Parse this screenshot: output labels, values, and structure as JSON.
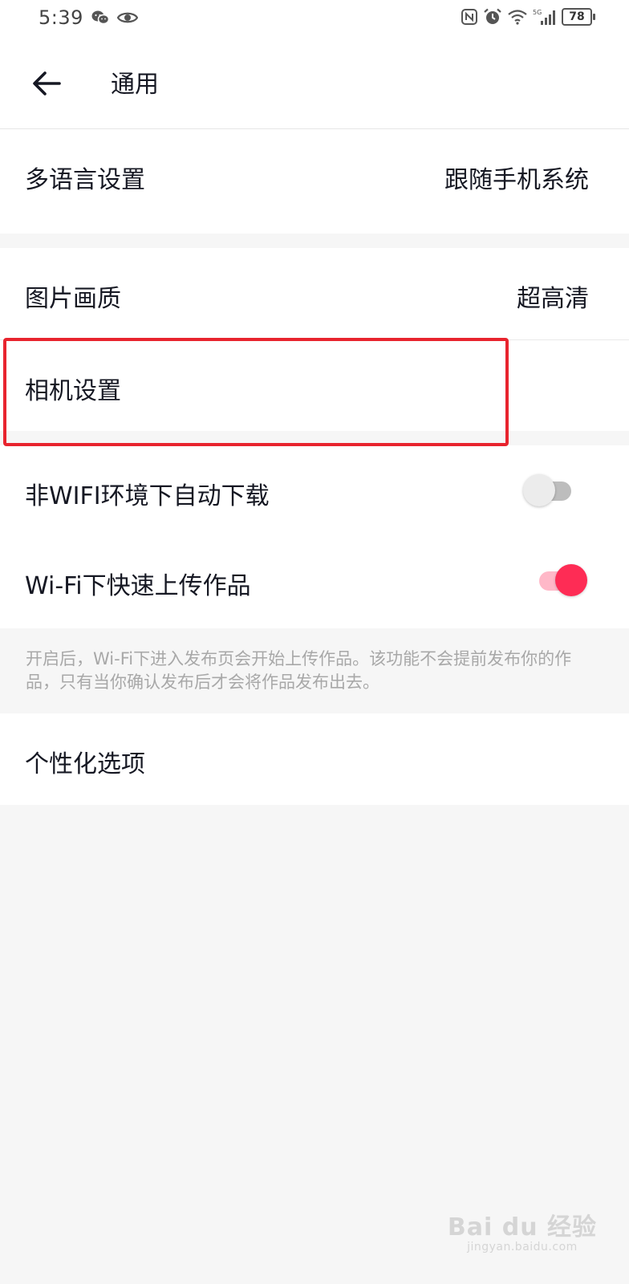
{
  "status_bar": {
    "time": "5:39",
    "battery": "78",
    "network": "5G"
  },
  "header": {
    "title": "通用"
  },
  "settings": {
    "language": {
      "label": "多语言设置",
      "value": "跟随手机系统"
    },
    "image_quality": {
      "label": "图片画质",
      "value": "超高清"
    },
    "camera": {
      "label": "相机设置"
    },
    "auto_download": {
      "label": "非WIFI环境下自动下载",
      "enabled": false
    },
    "fast_upload": {
      "label": "Wi-Fi下快速上传作品",
      "enabled": true
    },
    "fast_upload_hint": "开启后，Wi-Fi下进入发布页会开始上传作品。该功能不会提前发布你的作品，只有当你确认发布后才会将作品发布出去。",
    "personalization": {
      "label": "个性化选项"
    }
  },
  "watermark": {
    "main": "Bai du 经验",
    "sub": "jingyan.baidu.com"
  },
  "colors": {
    "accent": "#fe2c55",
    "highlight": "#e8242e",
    "background": "#f6f6f6"
  }
}
